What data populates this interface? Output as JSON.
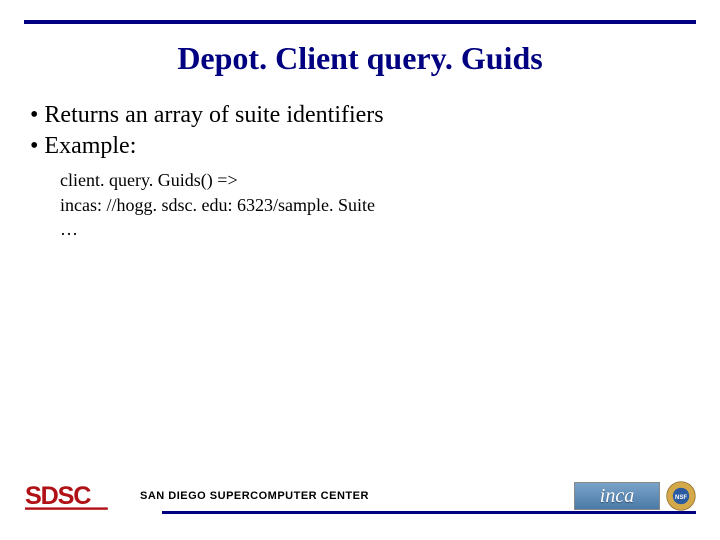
{
  "title": "Depot. Client query. Guids",
  "bullets": [
    "Returns an array of suite identifiers",
    "Example:"
  ],
  "code": {
    "line1": "client. query. Guids() =>",
    "line2": "incas: //hogg. sdsc. edu: 6323/sample. Suite",
    "line3": "…"
  },
  "footer": {
    "org_text": "SAN DIEGO SUPERCOMPUTER CENTER",
    "sdsc_logo_text": "SDSC",
    "inca_logo_text": "inca"
  },
  "colors": {
    "accent": "#000080",
    "sdsc_red": "#B01116"
  }
}
